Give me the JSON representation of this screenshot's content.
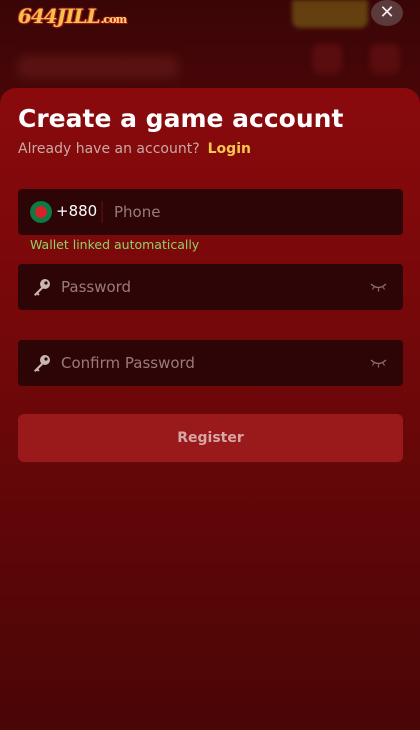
{
  "header": {
    "logo_text": "644JILL",
    "logo_suffix": ".com",
    "close_icon": "close-icon"
  },
  "form": {
    "title": "Create a game account",
    "subtitle": "Already have an account?",
    "login_link": "Login",
    "phone": {
      "country_code": "+880",
      "flag_icon": "bangladesh-flag-icon",
      "placeholder": "Phone",
      "value": "",
      "hint": "Wallet linked automatically"
    },
    "password": {
      "placeholder": "Password",
      "value": "",
      "icon": "key-icon",
      "toggle_icon": "eye-closed-icon"
    },
    "confirm_password": {
      "placeholder": "Confirm Password",
      "value": "",
      "icon": "key-icon",
      "toggle_icon": "eye-closed-icon"
    },
    "register_label": "Register"
  },
  "colors": {
    "accent": "#f5c84c",
    "sheet": "#8a0a0c",
    "field": "#2e0506",
    "hint": "#8fd16a",
    "button": "#9a1a1c"
  }
}
